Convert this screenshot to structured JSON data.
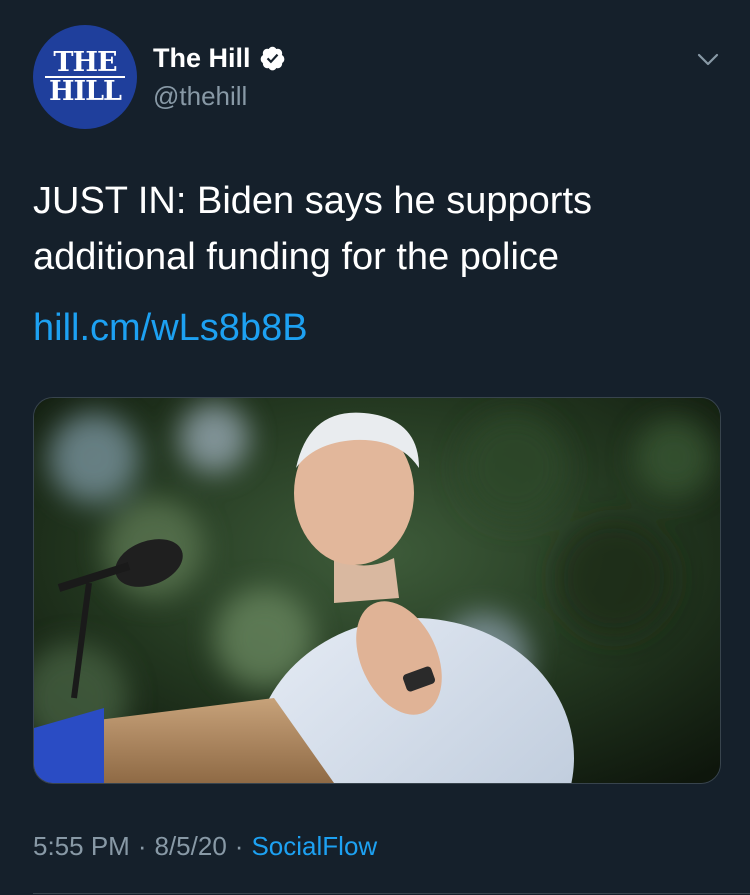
{
  "author": {
    "avatar_logo_line1": "THE",
    "avatar_logo_line2": "HILL",
    "display_name": "The Hill",
    "handle": "@thehill",
    "verified": true
  },
  "tweet": {
    "text": "JUST IN: Biden says he supports additional funding for the police",
    "link": "hill.cm/wLs8b8B"
  },
  "media": {
    "type": "photo"
  },
  "meta": {
    "time": "5:55 PM",
    "date": "8/5/20",
    "separator": "·",
    "source": "SocialFlow"
  },
  "colors": {
    "background": "#15202b",
    "accent": "#1da1f2",
    "secondary_text": "#8899a6",
    "avatar_bg": "#1f3f9c"
  },
  "icons": {
    "verified": "verified-badge-icon",
    "menu": "chevron-down-icon"
  }
}
